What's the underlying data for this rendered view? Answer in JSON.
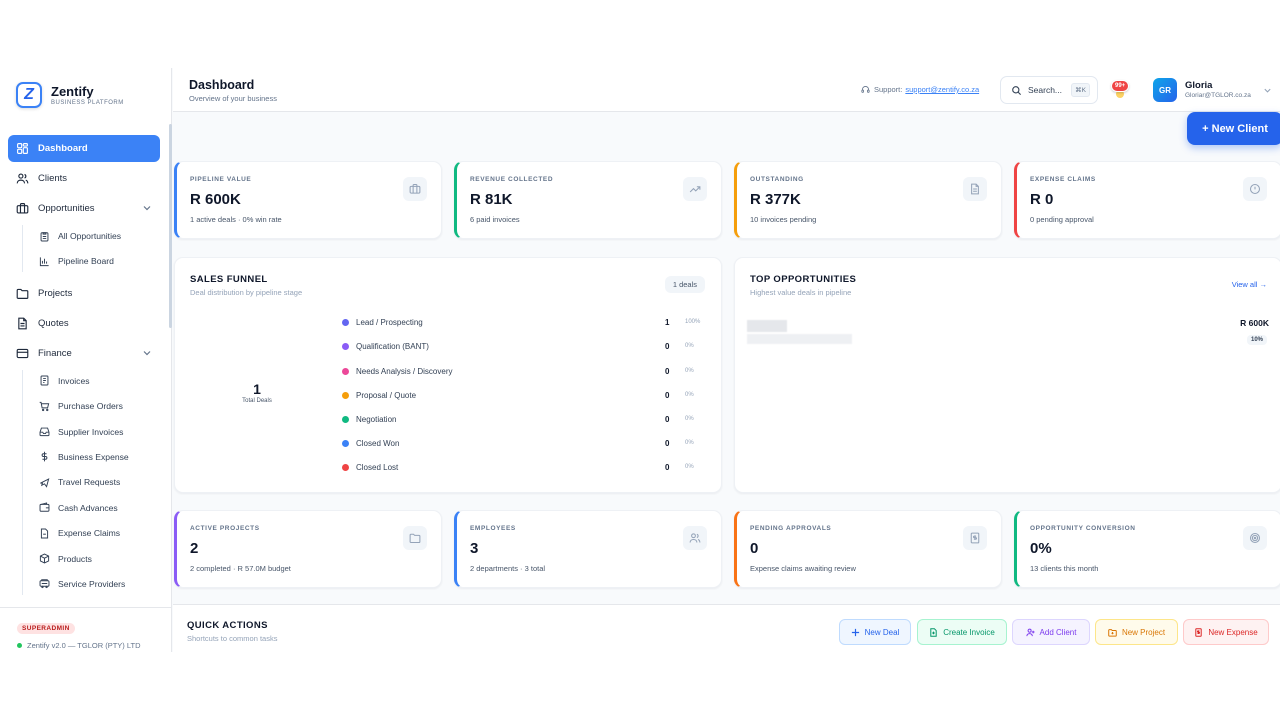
{
  "brand": {
    "name": "Zentify",
    "sub": "BUSINESS PLATFORM"
  },
  "sidebar": {
    "items": [
      {
        "label": "Dashboard"
      },
      {
        "label": "Clients"
      },
      {
        "label": "Opportunities"
      },
      {
        "label": "All Opportunities"
      },
      {
        "label": "Pipeline Board"
      },
      {
        "label": "Projects"
      },
      {
        "label": "Quotes"
      },
      {
        "label": "Finance"
      },
      {
        "label": "Invoices"
      },
      {
        "label": "Purchase Orders"
      },
      {
        "label": "Supplier Invoices"
      },
      {
        "label": "Business Expense"
      },
      {
        "label": "Travel Requests"
      },
      {
        "label": "Cash Advances"
      },
      {
        "label": "Expense Claims"
      },
      {
        "label": "Products"
      },
      {
        "label": "Service Providers"
      }
    ],
    "role": "SUPERADMIN",
    "version": "Zentify v2.0 — TGLOR (PTY) LTD"
  },
  "header": {
    "title": "Dashboard",
    "subtitle": "Overview of your business",
    "support_label": "Support:",
    "support_email": "support@zentify.co.za",
    "search_placeholder": "Search...",
    "search_kbd": "⌘K",
    "notif_count": "99+",
    "user_initials": "GR",
    "user_name": "Gloria",
    "user_email": "Gloriar@TGLOR.co.za"
  },
  "new_client_label": "+ New Client",
  "stats_top": [
    {
      "label": "PIPELINE VALUE",
      "value": "R 600K",
      "sub": "1 active deals · 0% win rate",
      "icon": "briefcase-icon",
      "color": "#3b82f6"
    },
    {
      "label": "REVENUE COLLECTED",
      "value": "R 81K",
      "sub": "6 paid invoices",
      "icon": "trending-up-icon",
      "color": "#10b981"
    },
    {
      "label": "OUTSTANDING",
      "value": "R 377K",
      "sub": "10 invoices pending",
      "icon": "document-icon",
      "color": "#f59e0b"
    },
    {
      "label": "EXPENSE CLAIMS",
      "value": "R 0",
      "sub": "0 pending approval",
      "icon": "alert-circle-icon",
      "color": "#ef4444"
    }
  ],
  "funnel": {
    "title": "SALES FUNNEL",
    "subtitle": "Deal distribution by pipeline stage",
    "badge": "1 deals",
    "total": "1",
    "total_label": "Total Deals",
    "stages": [
      {
        "name": "Lead / Prospecting",
        "count": "1",
        "pct": "100%",
        "color": "#6366f1"
      },
      {
        "name": "Qualification (BANT)",
        "count": "0",
        "pct": "0%",
        "color": "#8b5cf6"
      },
      {
        "name": "Needs Analysis / Discovery",
        "count": "0",
        "pct": "0%",
        "color": "#ec4899"
      },
      {
        "name": "Proposal / Quote",
        "count": "0",
        "pct": "0%",
        "color": "#f59e0b"
      },
      {
        "name": "Negotiation",
        "count": "0",
        "pct": "0%",
        "color": "#10b981"
      },
      {
        "name": "Closed Won",
        "count": "0",
        "pct": "0%",
        "color": "#3b82f6"
      },
      {
        "name": "Closed Lost",
        "count": "0",
        "pct": "0%",
        "color": "#ef4444"
      }
    ]
  },
  "top_opps": {
    "title": "TOP OPPORTUNITIES",
    "subtitle": "Highest value deals in pipeline",
    "view_all": "View all →",
    "items": [
      {
        "value": "R 600K",
        "pct": "10%"
      }
    ]
  },
  "stats_bottom": [
    {
      "label": "ACTIVE PROJECTS",
      "value": "2",
      "sub": "2 completed · R 57.0M budget",
      "icon": "folder-icon",
      "color": "#8b5cf6"
    },
    {
      "label": "EMPLOYEES",
      "value": "3",
      "sub": "2 departments · 3 total",
      "icon": "users-icon",
      "color": "#3b82f6"
    },
    {
      "label": "PENDING APPROVALS",
      "value": "0",
      "sub": "Expense claims awaiting review",
      "icon": "receipt-icon",
      "color": "#f97316"
    },
    {
      "label": "OPPORTUNITY CONVERSION",
      "value": "0%",
      "sub": "13 clients this month",
      "icon": "target-icon",
      "color": "#10b981"
    }
  ],
  "quick_actions": {
    "title": "QUICK ACTIONS",
    "subtitle": "Shortcuts to common tasks",
    "buttons": [
      {
        "label": "New Deal",
        "color": "#2563eb",
        "bg": "#eff6ff",
        "border": "#bfdbfe"
      },
      {
        "label": "Create Invoice",
        "color": "#059669",
        "bg": "#ecfdf5",
        "border": "#a7f3d0"
      },
      {
        "label": "Add Client",
        "color": "#7c3aed",
        "bg": "#f5f3ff",
        "border": "#ddd6fe"
      },
      {
        "label": "New Project",
        "color": "#d97706",
        "bg": "#fffbeb",
        "border": "#fde68a"
      },
      {
        "label": "New Expense",
        "color": "#dc2626",
        "bg": "#fef2f2",
        "border": "#fecaca"
      }
    ]
  }
}
